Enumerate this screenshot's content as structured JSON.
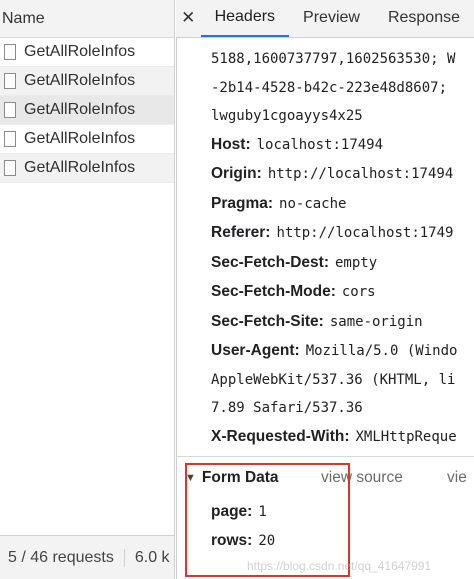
{
  "left_panel": {
    "header": "Name",
    "requests": [
      {
        "name": "GetAllRoleInfos"
      },
      {
        "name": "GetAllRoleInfos"
      },
      {
        "name": "GetAllRoleInfos"
      },
      {
        "name": "GetAllRoleInfos"
      },
      {
        "name": "GetAllRoleInfos"
      }
    ],
    "footer": {
      "count": "5 / 46 requests",
      "size": "6.0 k"
    }
  },
  "tabs": {
    "close_glyph": "✕",
    "items": [
      {
        "label": "Headers",
        "active": true
      },
      {
        "label": "Preview",
        "active": false
      },
      {
        "label": "Response",
        "active": false
      }
    ]
  },
  "headers": {
    "continuation": [
      "5188,1600737797,1602563530; W",
      "-2b14-4528-b42c-223e48d8607;",
      "lwguby1cgoayys4x25"
    ],
    "items": [
      {
        "key": "Host:",
        "value": "localhost:17494"
      },
      {
        "key": "Origin:",
        "value": "http://localhost:17494"
      },
      {
        "key": "Pragma:",
        "value": "no-cache"
      },
      {
        "key": "Referer:",
        "value": "http://localhost:1749"
      },
      {
        "key": "Sec-Fetch-Dest:",
        "value": "empty"
      },
      {
        "key": "Sec-Fetch-Mode:",
        "value": "cors"
      },
      {
        "key": "Sec-Fetch-Site:",
        "value": "same-origin"
      },
      {
        "key": "User-Agent:",
        "value": "Mozilla/5.0 (Windo"
      }
    ],
    "user_agent_continuation": [
      "AppleWebKit/537.36 (KHTML, li",
      "7.89 Safari/537.36"
    ],
    "x_requested_with": {
      "key": "X-Requested-With:",
      "value": "XMLHttpReque"
    }
  },
  "form_data": {
    "title": "Form Data",
    "view_source": "view source",
    "view_cut": "vie",
    "rows": [
      {
        "key": "page:",
        "value": "1"
      },
      {
        "key": "rows:",
        "value": "20"
      }
    ]
  },
  "watermark": "https://blog.csdn.net/qq_41647991",
  "colors": {
    "accent": "#1a73e8",
    "highlight_border": "#e8302a"
  }
}
